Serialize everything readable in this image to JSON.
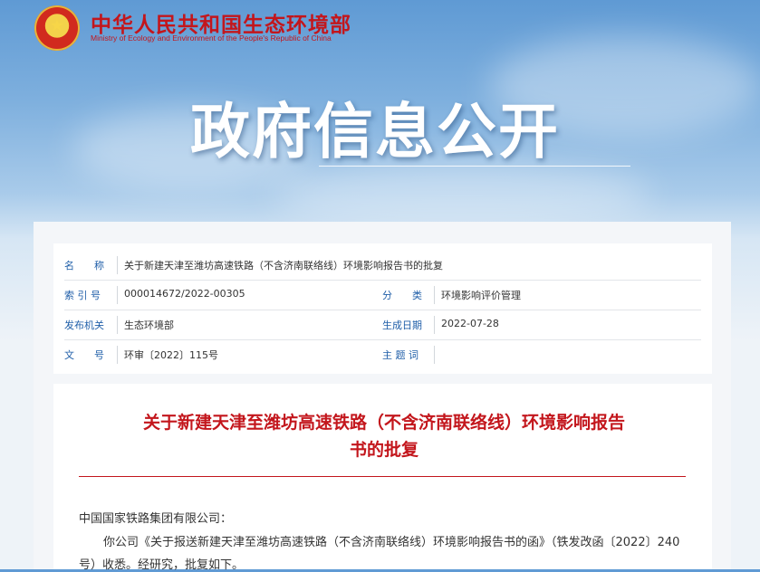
{
  "header": {
    "ministry_cn": "中华人民共和国生态环境部",
    "ministry_en": "Ministry of Ecology and Environment of the People's Republic of China",
    "banner_title": "政府信息公开"
  },
  "meta": {
    "name_label": "名　　称",
    "name_value": "关于新建天津至潍坊高速铁路（不含济南联络线）环境影响报告书的批复",
    "index_label": "索 引 号",
    "index_value": "000014672/2022-00305",
    "category_label": "分　　类",
    "category_value": "环境影响评价管理",
    "issuer_label": "发布机关",
    "issuer_value": "生态环境部",
    "date_label": "生成日期",
    "date_value": "2022-07-28",
    "docno_label": "文　　号",
    "docno_value": "环审〔2022〕115号",
    "topic_label": "主 题 词",
    "topic_value": ""
  },
  "document": {
    "title_line1": "关于新建天津至潍坊高速铁路（不含济南联络线）环境影响报告",
    "title_line2": "书的批复",
    "salutation": "中国国家铁路集团有限公司：",
    "para1_line1": "你公司《关于报送新建天津至潍坊高速铁路（不含济南联络线）环境影响报告书的函》（铁发改函〔2022〕240",
    "para1_line2": "号）收悉。经研究，批复如下。"
  },
  "colors": {
    "accent_red": "#c3161c",
    "label_blue": "#1f5ea8"
  }
}
